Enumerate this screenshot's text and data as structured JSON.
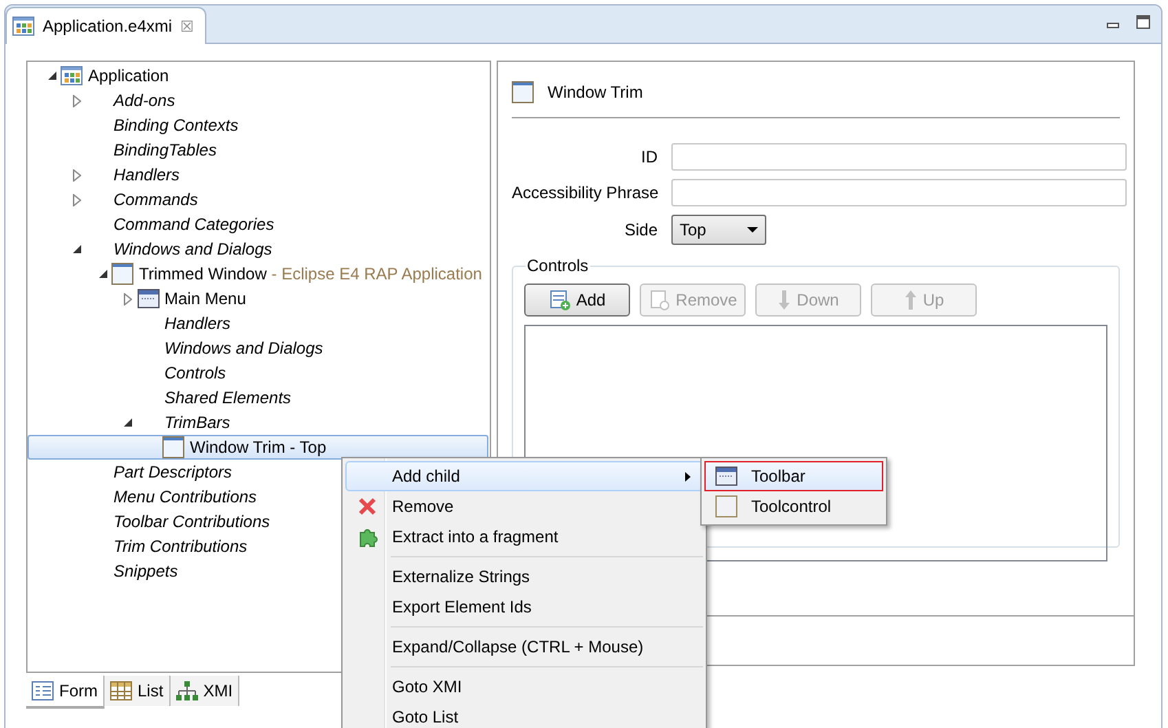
{
  "editor_tab": {
    "title": "Application.e4xmi",
    "close": "☒"
  },
  "tree": [
    {
      "label": "Application",
      "kind": "application",
      "expanded": true,
      "selected": false,
      "children": [
        {
          "label": "Add-ons",
          "kind": "category",
          "expanded": false,
          "selected": false
        },
        {
          "label": "Binding Contexts",
          "kind": "category",
          "selected": false
        },
        {
          "label": "BindingTables",
          "kind": "category",
          "selected": false
        },
        {
          "label": "Handlers",
          "kind": "category",
          "expanded": false,
          "selected": false
        },
        {
          "label": "Commands",
          "kind": "category",
          "expanded": false,
          "selected": false
        },
        {
          "label": "Command Categories",
          "kind": "category",
          "selected": false
        },
        {
          "label": "Windows and Dialogs",
          "kind": "category",
          "expanded": true,
          "selected": false,
          "children": [
            {
              "label": "Trimmed Window",
              "detail": " - Eclipse E4 RAP Application",
              "kind": "window",
              "expanded": true,
              "selected": false,
              "children": [
                {
                  "label": "Main Menu",
                  "kind": "menu",
                  "expanded": false,
                  "selected": false
                },
                {
                  "label": "Handlers",
                  "kind": "category",
                  "selected": false
                },
                {
                  "label": "Windows and Dialogs",
                  "kind": "category",
                  "selected": false
                },
                {
                  "label": "Controls",
                  "kind": "category",
                  "selected": false
                },
                {
                  "label": "Shared Elements",
                  "kind": "category",
                  "selected": false
                },
                {
                  "label": "TrimBars",
                  "kind": "category",
                  "expanded": true,
                  "selected": false,
                  "children": [
                    {
                      "label": "Window Trim - Top",
                      "kind": "window",
                      "selected": true
                    }
                  ]
                }
              ]
            }
          ]
        },
        {
          "label": "Part Descriptors",
          "kind": "category",
          "selected": false
        },
        {
          "label": "Menu Contributions",
          "kind": "category",
          "selected": false
        },
        {
          "label": "Toolbar Contributions",
          "kind": "category",
          "selected": false
        },
        {
          "label": "Trim Contributions",
          "kind": "category",
          "selected": false
        },
        {
          "label": "Snippets",
          "kind": "category",
          "selected": false
        }
      ]
    }
  ],
  "detail": {
    "title": "Window Trim",
    "fields": [
      {
        "label": "ID",
        "kind": "text"
      },
      {
        "label": "Accessibility Phrase",
        "kind": "text"
      },
      {
        "label": "Side",
        "kind": "select",
        "value": "Top"
      }
    ],
    "controls": {
      "title": "Controls",
      "buttons": [
        {
          "label": "Add",
          "kind": "add",
          "disabled": false
        },
        {
          "label": "Remove",
          "kind": "remove",
          "disabled": true
        },
        {
          "label": "Down",
          "kind": "down",
          "disabled": true
        },
        {
          "label": "Up",
          "kind": "up",
          "disabled": true
        }
      ]
    }
  },
  "bottom_tabs": [
    {
      "label": "Form",
      "kind": "form",
      "selected": true
    },
    {
      "label": "List",
      "kind": "list",
      "selected": false
    },
    {
      "label": "XMI",
      "kind": "xmi",
      "selected": false
    }
  ],
  "context_menu": {
    "groups": [
      [
        {
          "label": "Add child",
          "kind": "submenu",
          "highlighted": true
        },
        {
          "label": "Remove",
          "kind": "remove",
          "highlighted": false
        },
        {
          "label": "Extract into a fragment",
          "kind": "extract",
          "highlighted": false
        }
      ],
      [
        {
          "label": "Externalize Strings",
          "kind": "plain",
          "highlighted": false
        },
        {
          "label": "Export Element Ids",
          "kind": "plain",
          "highlighted": false
        }
      ],
      [
        {
          "label": "Expand/Collapse (CTRL + Mouse)",
          "kind": "plain",
          "highlighted": false
        }
      ],
      [
        {
          "label": "Goto XMI",
          "kind": "plain",
          "highlighted": false
        },
        {
          "label": "Goto List",
          "kind": "plain",
          "highlighted": false
        }
      ]
    ]
  },
  "submenu": [
    {
      "label": "Toolbar",
      "kind": "toolbar",
      "highlighted": true
    },
    {
      "label": "Toolcontrol",
      "kind": "toolcontrol",
      "highlighted": false
    }
  ]
}
